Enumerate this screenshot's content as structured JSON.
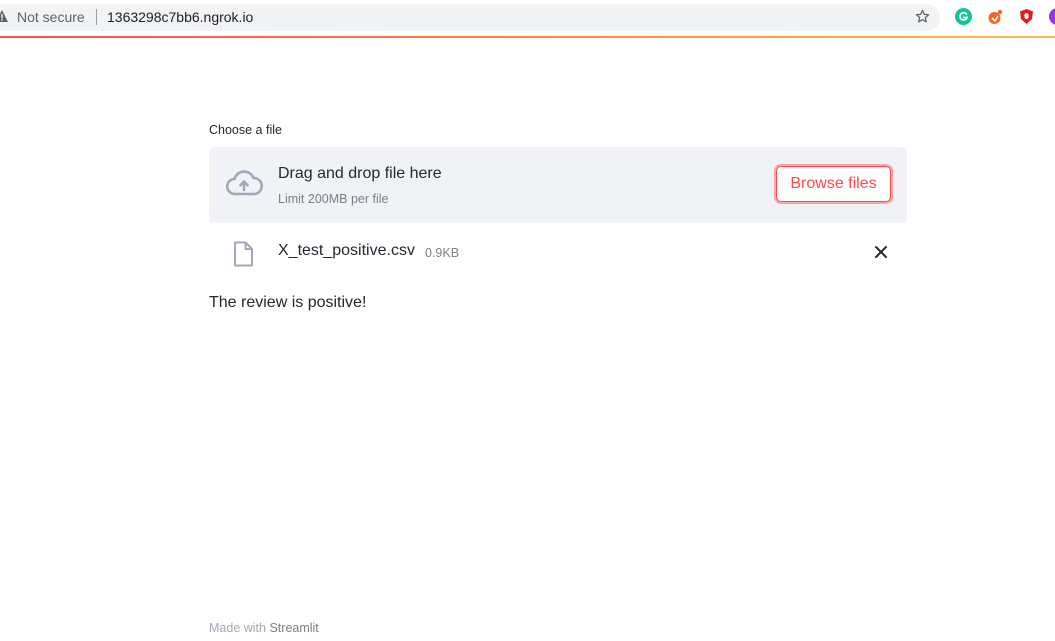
{
  "browser": {
    "security_label": "Not secure",
    "url": "1363298c7bb6.ngrok.io",
    "icons": [
      "warning-icon",
      "bookmark-star-icon",
      "grammarly-icon",
      "orange-extension-icon",
      "red-extension-icon",
      "purple-extension-icon"
    ]
  },
  "uploader": {
    "label": "Choose a file",
    "drop_title": "Drag and drop file here",
    "drop_limit": "Limit 200MB per file",
    "browse_label": "Browse files",
    "icon": "cloud-upload-icon"
  },
  "file": {
    "name": "X_test_positive.csv",
    "size": "0.9KB",
    "icon": "file-icon",
    "remove_icon": "close-icon"
  },
  "result": {
    "text": "The review is positive!"
  },
  "footer": {
    "prefix": "Made with",
    "link": "Streamlit"
  },
  "colors": {
    "accent": "#ff4b4b",
    "dropzone_bg": "#f0f2f6",
    "text": "#262730",
    "muted": "#7b7f8a"
  }
}
